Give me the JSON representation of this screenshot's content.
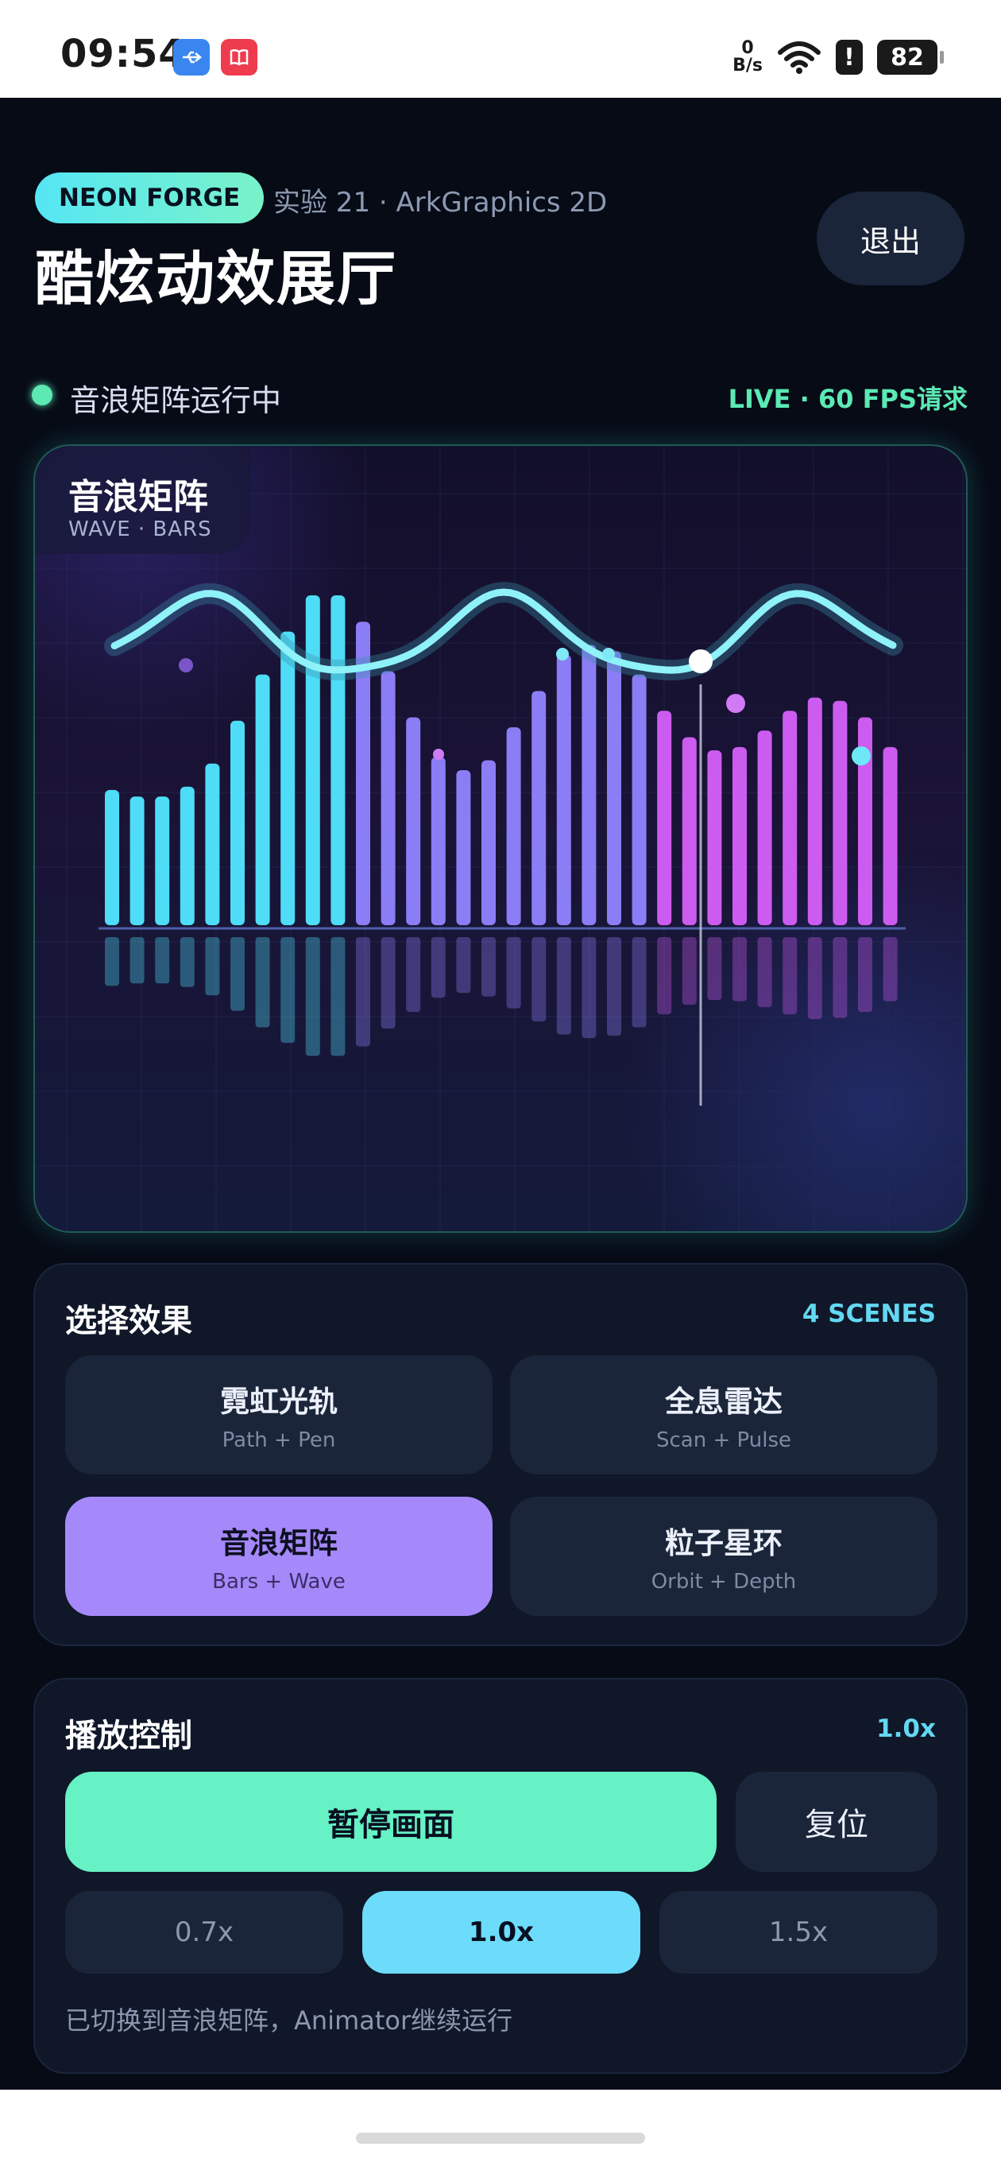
{
  "status_bar": {
    "time": "09:54",
    "net_rate_value": "0",
    "net_rate_unit": "B/s",
    "battery": "82",
    "icons": [
      "usb-icon",
      "book-icon",
      "wifi-icon",
      "alert-icon",
      "battery-icon"
    ]
  },
  "header": {
    "tag": "NEON FORGE",
    "subtitle": "实验 21 · ArkGraphics 2D",
    "title": "酷炫动效展厅",
    "exit_label": "退出"
  },
  "status": {
    "text": "音浪矩阵运行中",
    "live": "LIVE · 60 FPS请求"
  },
  "visual": {
    "title": "音浪矩阵",
    "subtitle": "WAVE · BARS",
    "bar_levels": [
      0.41,
      0.39,
      0.39,
      0.42,
      0.49,
      0.62,
      0.76,
      0.89,
      1.0,
      1.0,
      0.92,
      0.77,
      0.63,
      0.51,
      0.47,
      0.5,
      0.6,
      0.71,
      0.82,
      0.85,
      0.83,
      0.76,
      0.65,
      0.57,
      0.53,
      0.54,
      0.59,
      0.65,
      0.69,
      0.68,
      0.63,
      0.54
    ],
    "colors": {
      "cyan": "#4fdcf6",
      "violet": "#8b7df5",
      "magenta": "#cc5cf0",
      "wave": "#8ef2f8"
    }
  },
  "scenes": {
    "title": "选择效果",
    "count": "4 SCENES",
    "items": [
      {
        "name": "霓虹光轨",
        "en": "Path + Pen"
      },
      {
        "name": "全息雷达",
        "en": "Scan + Pulse"
      },
      {
        "name": "音浪矩阵",
        "en": "Bars + Wave"
      },
      {
        "name": "粒子星环",
        "en": "Orbit + Depth"
      }
    ],
    "selected": "音浪矩阵"
  },
  "playback": {
    "title": "播放控制",
    "speed_display": "1.0x",
    "pause_label": "暂停画面",
    "reset_label": "复位",
    "speeds": [
      "0.7x",
      "1.0x",
      "1.5x"
    ],
    "selected_speed": "1.0x",
    "log": "已切换到音浪矩阵，Animator继续运行"
  },
  "theme": {
    "background": "#070b16",
    "accent_green": "#66f2c4",
    "accent_cyan": "#6ddcfb",
    "accent_violet": "#a589fa"
  }
}
